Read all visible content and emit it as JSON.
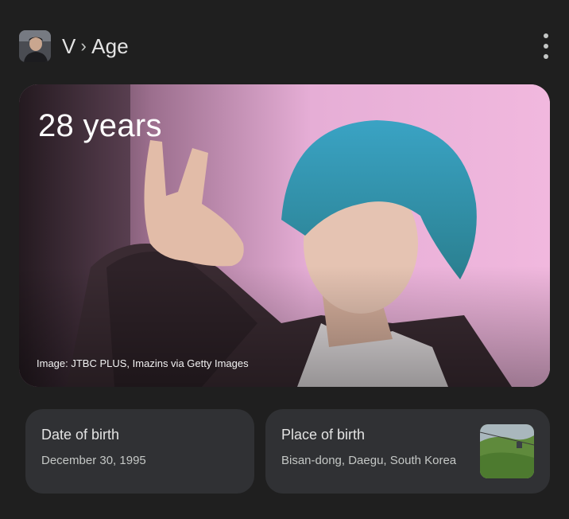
{
  "header": {
    "entity": "V",
    "separator": "›",
    "attribute": "Age"
  },
  "hero": {
    "age_text": "28 years",
    "image_credit": "Image: JTBC PLUS, Imazins via Getty Images"
  },
  "cards": {
    "date_of_birth": {
      "title": "Date of birth",
      "value": "December 30, 1995"
    },
    "place_of_birth": {
      "title": "Place of birth",
      "value": "Bisan-dong, Daegu, South Korea"
    }
  },
  "icons": {
    "more": "more-vert-icon"
  },
  "colors": {
    "background": "#1f1f1f",
    "card": "#303134",
    "text_primary": "#e3e3e3",
    "text_secondary": "#c4c7c5"
  }
}
